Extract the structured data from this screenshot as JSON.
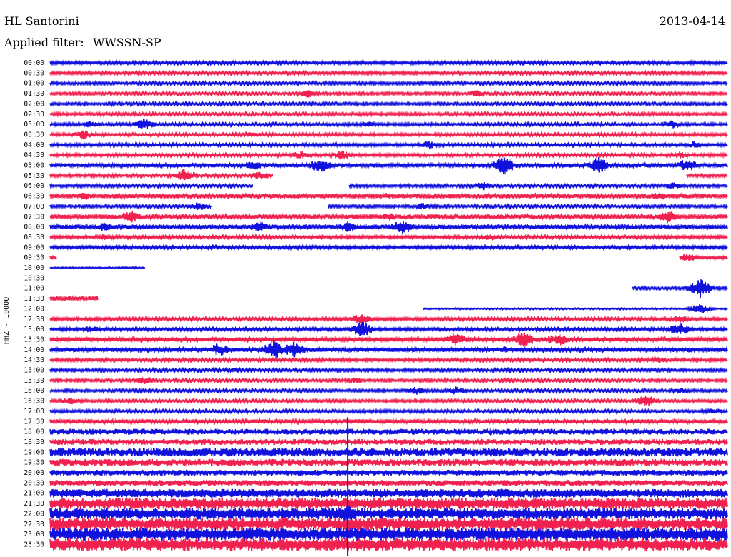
{
  "header": {
    "station": "HL Santorini",
    "date": "2013-04-14",
    "filter_label": "Applied filter:",
    "filter_value": "WWSSN-SP"
  },
  "colors": {
    "trace_a": "#1111dd",
    "trace_b": "#f0214f",
    "text": "#000000"
  },
  "chart_data": {
    "type": "line",
    "title": "HL Santorini",
    "ylabel": "HHZ - 10000",
    "y_tick_labels": [
      "00:00",
      "00:30",
      "01:00",
      "01:30",
      "02:00",
      "02:30",
      "03:00",
      "03:30",
      "04:00",
      "04:30",
      "05:00",
      "05:30",
      "06:00",
      "06:30",
      "07:00",
      "07:30",
      "08:00",
      "08:30",
      "09:00",
      "09:30",
      "10:00",
      "10:30",
      "11:00",
      "11:30",
      "12:00",
      "12:30",
      "13:00",
      "13:30",
      "14:00",
      "14:30",
      "15:00",
      "15:30",
      "16:00",
      "16:30",
      "17:00",
      "17:30",
      "18:00",
      "18:30",
      "19:00",
      "19:30",
      "20:00",
      "20:30",
      "21:00",
      "21:30",
      "22:00",
      "22:30",
      "23:00",
      "23:30"
    ],
    "rows": [
      {
        "time": "00:00",
        "amp": 2,
        "gaps": [],
        "events": []
      },
      {
        "time": "00:30",
        "amp": 2,
        "gaps": [],
        "events": []
      },
      {
        "time": "01:00",
        "amp": 2,
        "gaps": [],
        "events": []
      },
      {
        "time": "01:30",
        "amp": 2,
        "gaps": [],
        "events": [
          [
            0.38,
            6
          ],
          [
            0.63,
            5
          ]
        ]
      },
      {
        "time": "02:00",
        "amp": 2,
        "gaps": [],
        "events": []
      },
      {
        "time": "02:30",
        "amp": 2,
        "gaps": [],
        "events": []
      },
      {
        "time": "03:00",
        "amp": 2,
        "gaps": [],
        "events": [
          [
            0.06,
            5
          ],
          [
            0.14,
            8
          ],
          [
            0.47,
            4
          ],
          [
            0.92,
            6
          ]
        ]
      },
      {
        "time": "03:30",
        "amp": 2,
        "gaps": [],
        "events": [
          [
            0.05,
            7
          ],
          [
            0.3,
            4
          ]
        ]
      },
      {
        "time": "04:00",
        "amp": 2,
        "gaps": [],
        "events": [
          [
            0.56,
            6
          ],
          [
            0.95,
            5
          ]
        ]
      },
      {
        "time": "04:30",
        "amp": 2,
        "gaps": [],
        "events": [
          [
            0.37,
            6
          ],
          [
            0.43,
            7
          ],
          [
            0.93,
            5
          ]
        ]
      },
      {
        "time": "05:00",
        "amp": 3,
        "gaps": [],
        "events": [
          [
            0.3,
            7
          ],
          [
            0.4,
            12
          ],
          [
            0.67,
            14
          ],
          [
            0.81,
            12
          ],
          [
            0.94,
            10
          ]
        ]
      },
      {
        "time": "05:30",
        "amp": 2,
        "gaps": [
          [
            0.33,
            0.94
          ]
        ],
        "events": [
          [
            0.2,
            10
          ],
          [
            0.31,
            6
          ]
        ]
      },
      {
        "time": "06:00",
        "amp": 2,
        "gaps": [
          [
            0.3,
            0.44
          ]
        ],
        "events": [
          [
            0.64,
            6
          ],
          [
            0.92,
            5
          ]
        ]
      },
      {
        "time": "06:30",
        "amp": 3,
        "gaps": [],
        "events": [
          [
            0.05,
            6
          ],
          [
            0.5,
            5
          ],
          [
            0.9,
            6
          ]
        ]
      },
      {
        "time": "07:00",
        "amp": 2,
        "gaps": [
          [
            0.24,
            0.41
          ]
        ],
        "events": [
          [
            0.22,
            6
          ],
          [
            0.55,
            5
          ]
        ]
      },
      {
        "time": "07:30",
        "amp": 3,
        "gaps": [],
        "events": [
          [
            0.12,
            9
          ],
          [
            0.5,
            6
          ],
          [
            0.91,
            10
          ]
        ]
      },
      {
        "time": "08:00",
        "amp": 3,
        "gaps": [],
        "events": [
          [
            0.08,
            7
          ],
          [
            0.31,
            9
          ],
          [
            0.44,
            8
          ],
          [
            0.52,
            11
          ]
        ]
      },
      {
        "time": "08:30",
        "amp": 2,
        "gaps": [],
        "events": [
          [
            0.08,
            5
          ],
          [
            0.65,
            5
          ]
        ]
      },
      {
        "time": "09:00",
        "amp": 2,
        "gaps": [],
        "events": []
      },
      {
        "time": "09:30",
        "amp": 2,
        "gaps": [
          [
            0.01,
            0.93
          ]
        ],
        "events": [
          [
            0.94,
            7
          ]
        ]
      },
      {
        "time": "10:00",
        "amp": 1,
        "gaps": [
          [
            0.14,
            1.0
          ]
        ],
        "events": []
      },
      {
        "time": "10:30",
        "amp": 0,
        "gaps": [
          [
            0.0,
            1.0
          ]
        ],
        "events": []
      },
      {
        "time": "11:00",
        "amp": 2,
        "gaps": [
          [
            0.0,
            0.86
          ]
        ],
        "events": [
          [
            0.96,
            14
          ]
        ]
      },
      {
        "time": "11:30",
        "amp": 3,
        "gaps": [
          [
            0.07,
            1.0
          ]
        ],
        "events": []
      },
      {
        "time": "12:00",
        "amp": 1,
        "gaps": [
          [
            0.0,
            0.55
          ]
        ],
        "events": [
          [
            0.96,
            7
          ]
        ]
      },
      {
        "time": "12:30",
        "amp": 2,
        "gaps": [],
        "events": [
          [
            0.46,
            8
          ],
          [
            0.93,
            6
          ]
        ]
      },
      {
        "time": "13:00",
        "amp": 2,
        "gaps": [],
        "events": [
          [
            0.46,
            12
          ],
          [
            0.06,
            5
          ],
          [
            0.93,
            10
          ]
        ]
      },
      {
        "time": "13:30",
        "amp": 3,
        "gaps": [],
        "events": [
          [
            0.6,
            10
          ],
          [
            0.7,
            12
          ],
          [
            0.75,
            10
          ]
        ]
      },
      {
        "time": "14:00",
        "amp": 3,
        "gaps": [],
        "events": [
          [
            0.25,
            10
          ],
          [
            0.33,
            14
          ],
          [
            0.36,
            12
          ],
          [
            0.67,
            5
          ],
          [
            0.95,
            5
          ]
        ]
      },
      {
        "time": "14:30",
        "amp": 2,
        "gaps": [],
        "events": [
          [
            0.9,
            4
          ]
        ]
      },
      {
        "time": "15:00",
        "amp": 2,
        "gaps": [],
        "events": [
          [
            0.27,
            4
          ]
        ]
      },
      {
        "time": "15:30",
        "amp": 2,
        "gaps": [],
        "events": [
          [
            0.14,
            6
          ],
          [
            0.45,
            5
          ]
        ]
      },
      {
        "time": "16:00",
        "amp": 2,
        "gaps": [],
        "events": [
          [
            0.54,
            6
          ],
          [
            0.6,
            6
          ],
          [
            0.93,
            5
          ]
        ]
      },
      {
        "time": "16:30",
        "amp": 2,
        "gaps": [],
        "events": [
          [
            0.03,
            6
          ],
          [
            0.88,
            9
          ]
        ]
      },
      {
        "time": "17:00",
        "amp": 2,
        "gaps": [],
        "events": [
          [
            0.98,
            5
          ]
        ]
      },
      {
        "time": "17:30",
        "amp": 3,
        "gaps": [],
        "events": []
      },
      {
        "time": "18:00",
        "amp": 4,
        "gaps": [],
        "events": [
          [
            0.65,
            5
          ]
        ]
      },
      {
        "time": "18:30",
        "amp": 4,
        "gaps": [],
        "events": []
      },
      {
        "time": "19:00",
        "amp": 6,
        "gaps": [],
        "events": []
      },
      {
        "time": "19:30",
        "amp": 5,
        "gaps": [],
        "events": []
      },
      {
        "time": "20:00",
        "amp": 4,
        "gaps": [],
        "events": []
      },
      {
        "time": "20:30",
        "amp": 4,
        "gaps": [],
        "events": []
      },
      {
        "time": "21:00",
        "amp": 6,
        "gaps": [],
        "events": []
      },
      {
        "time": "21:30",
        "amp": 8,
        "gaps": [],
        "events": []
      },
      {
        "time": "22:00",
        "amp": 8,
        "gaps": [],
        "events": [
          [
            0.44,
            16
          ]
        ]
      },
      {
        "time": "22:30",
        "amp": 9,
        "gaps": [],
        "events": [
          [
            0.44,
            14
          ]
        ]
      },
      {
        "time": "23:00",
        "amp": 9,
        "gaps": [],
        "events": []
      },
      {
        "time": "23:30",
        "amp": 9,
        "gaps": [],
        "events": []
      }
    ],
    "spike": {
      "x": 0.44,
      "from_time": "17:30",
      "to_time": "23:30"
    }
  }
}
